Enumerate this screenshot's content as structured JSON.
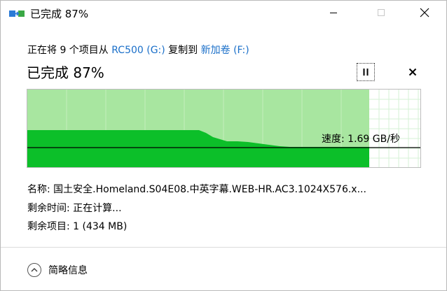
{
  "window": {
    "title": "已完成 87%",
    "controls": {
      "minimize": "minimize",
      "maximize": "maximize",
      "close": "close"
    }
  },
  "copy": {
    "prefix": "正在将 9 个项目从 ",
    "source": "RC500 (G:)",
    "middle": " 复制到 ",
    "destination": "新加卷 (F:)"
  },
  "status": {
    "heading": "已完成 87%",
    "percent": 87
  },
  "graph": {
    "speed_text": "速度: 1.69 GB/秒",
    "colors": {
      "done_light": "#a8e6a0",
      "done_dark": "#0cbf29",
      "remaining_grid": "#d6f0d6"
    }
  },
  "details": {
    "name_label": "名称: ",
    "name_value": "国土安全.Homeland.S04E08.中英字幕.WEB-HR.AC3.1024X576.x...",
    "time_label": "剩余时间: ",
    "time_value": "正在计算...",
    "items_label": "剩余项目: ",
    "items_value": "1 (434 MB)"
  },
  "footer": {
    "toggle_label": "简略信息"
  },
  "icons": {
    "app": "copy-files-icon",
    "pause": "pause-icon",
    "cancel": "close-icon",
    "chevron": "chevron-up-icon"
  }
}
